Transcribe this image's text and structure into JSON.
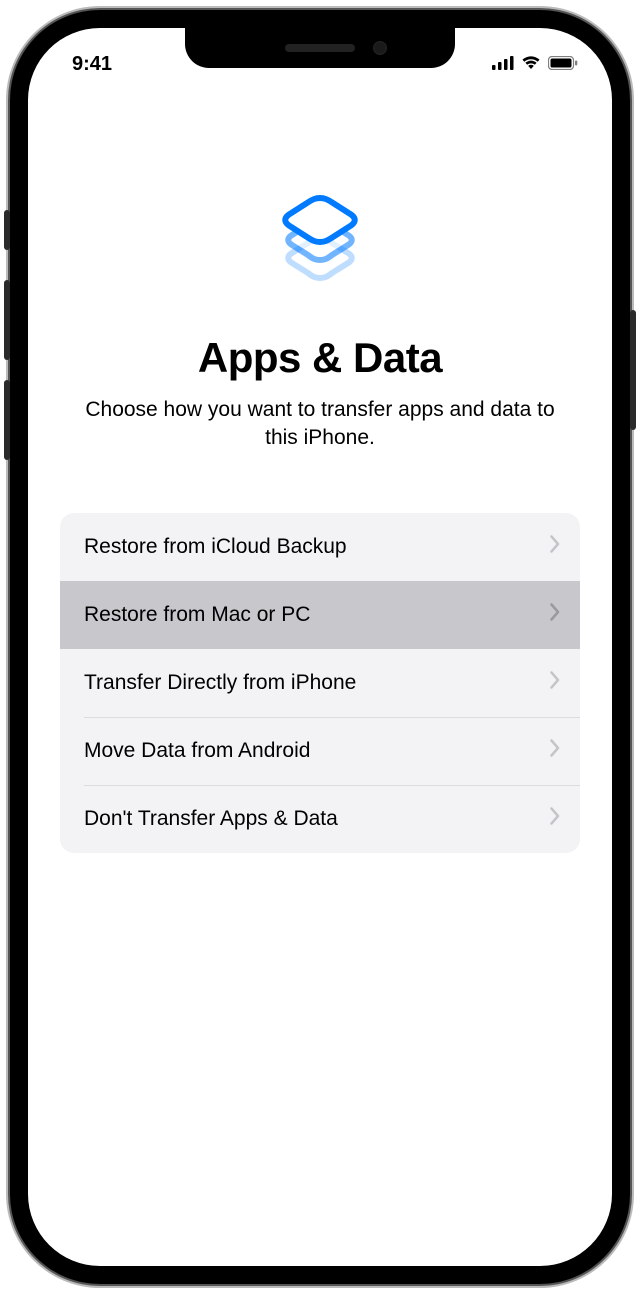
{
  "status": {
    "time": "9:41"
  },
  "header": {
    "title": "Apps & Data",
    "subtitle": "Choose how you want to transfer apps and data to this iPhone."
  },
  "options": [
    {
      "label": "Restore from iCloud Backup",
      "highlighted": false
    },
    {
      "label": "Restore from Mac or PC",
      "highlighted": true
    },
    {
      "label": "Transfer Directly from iPhone",
      "highlighted": false
    },
    {
      "label": "Move Data from Android",
      "highlighted": false
    },
    {
      "label": "Don't Transfer Apps & Data",
      "highlighted": false
    }
  ]
}
